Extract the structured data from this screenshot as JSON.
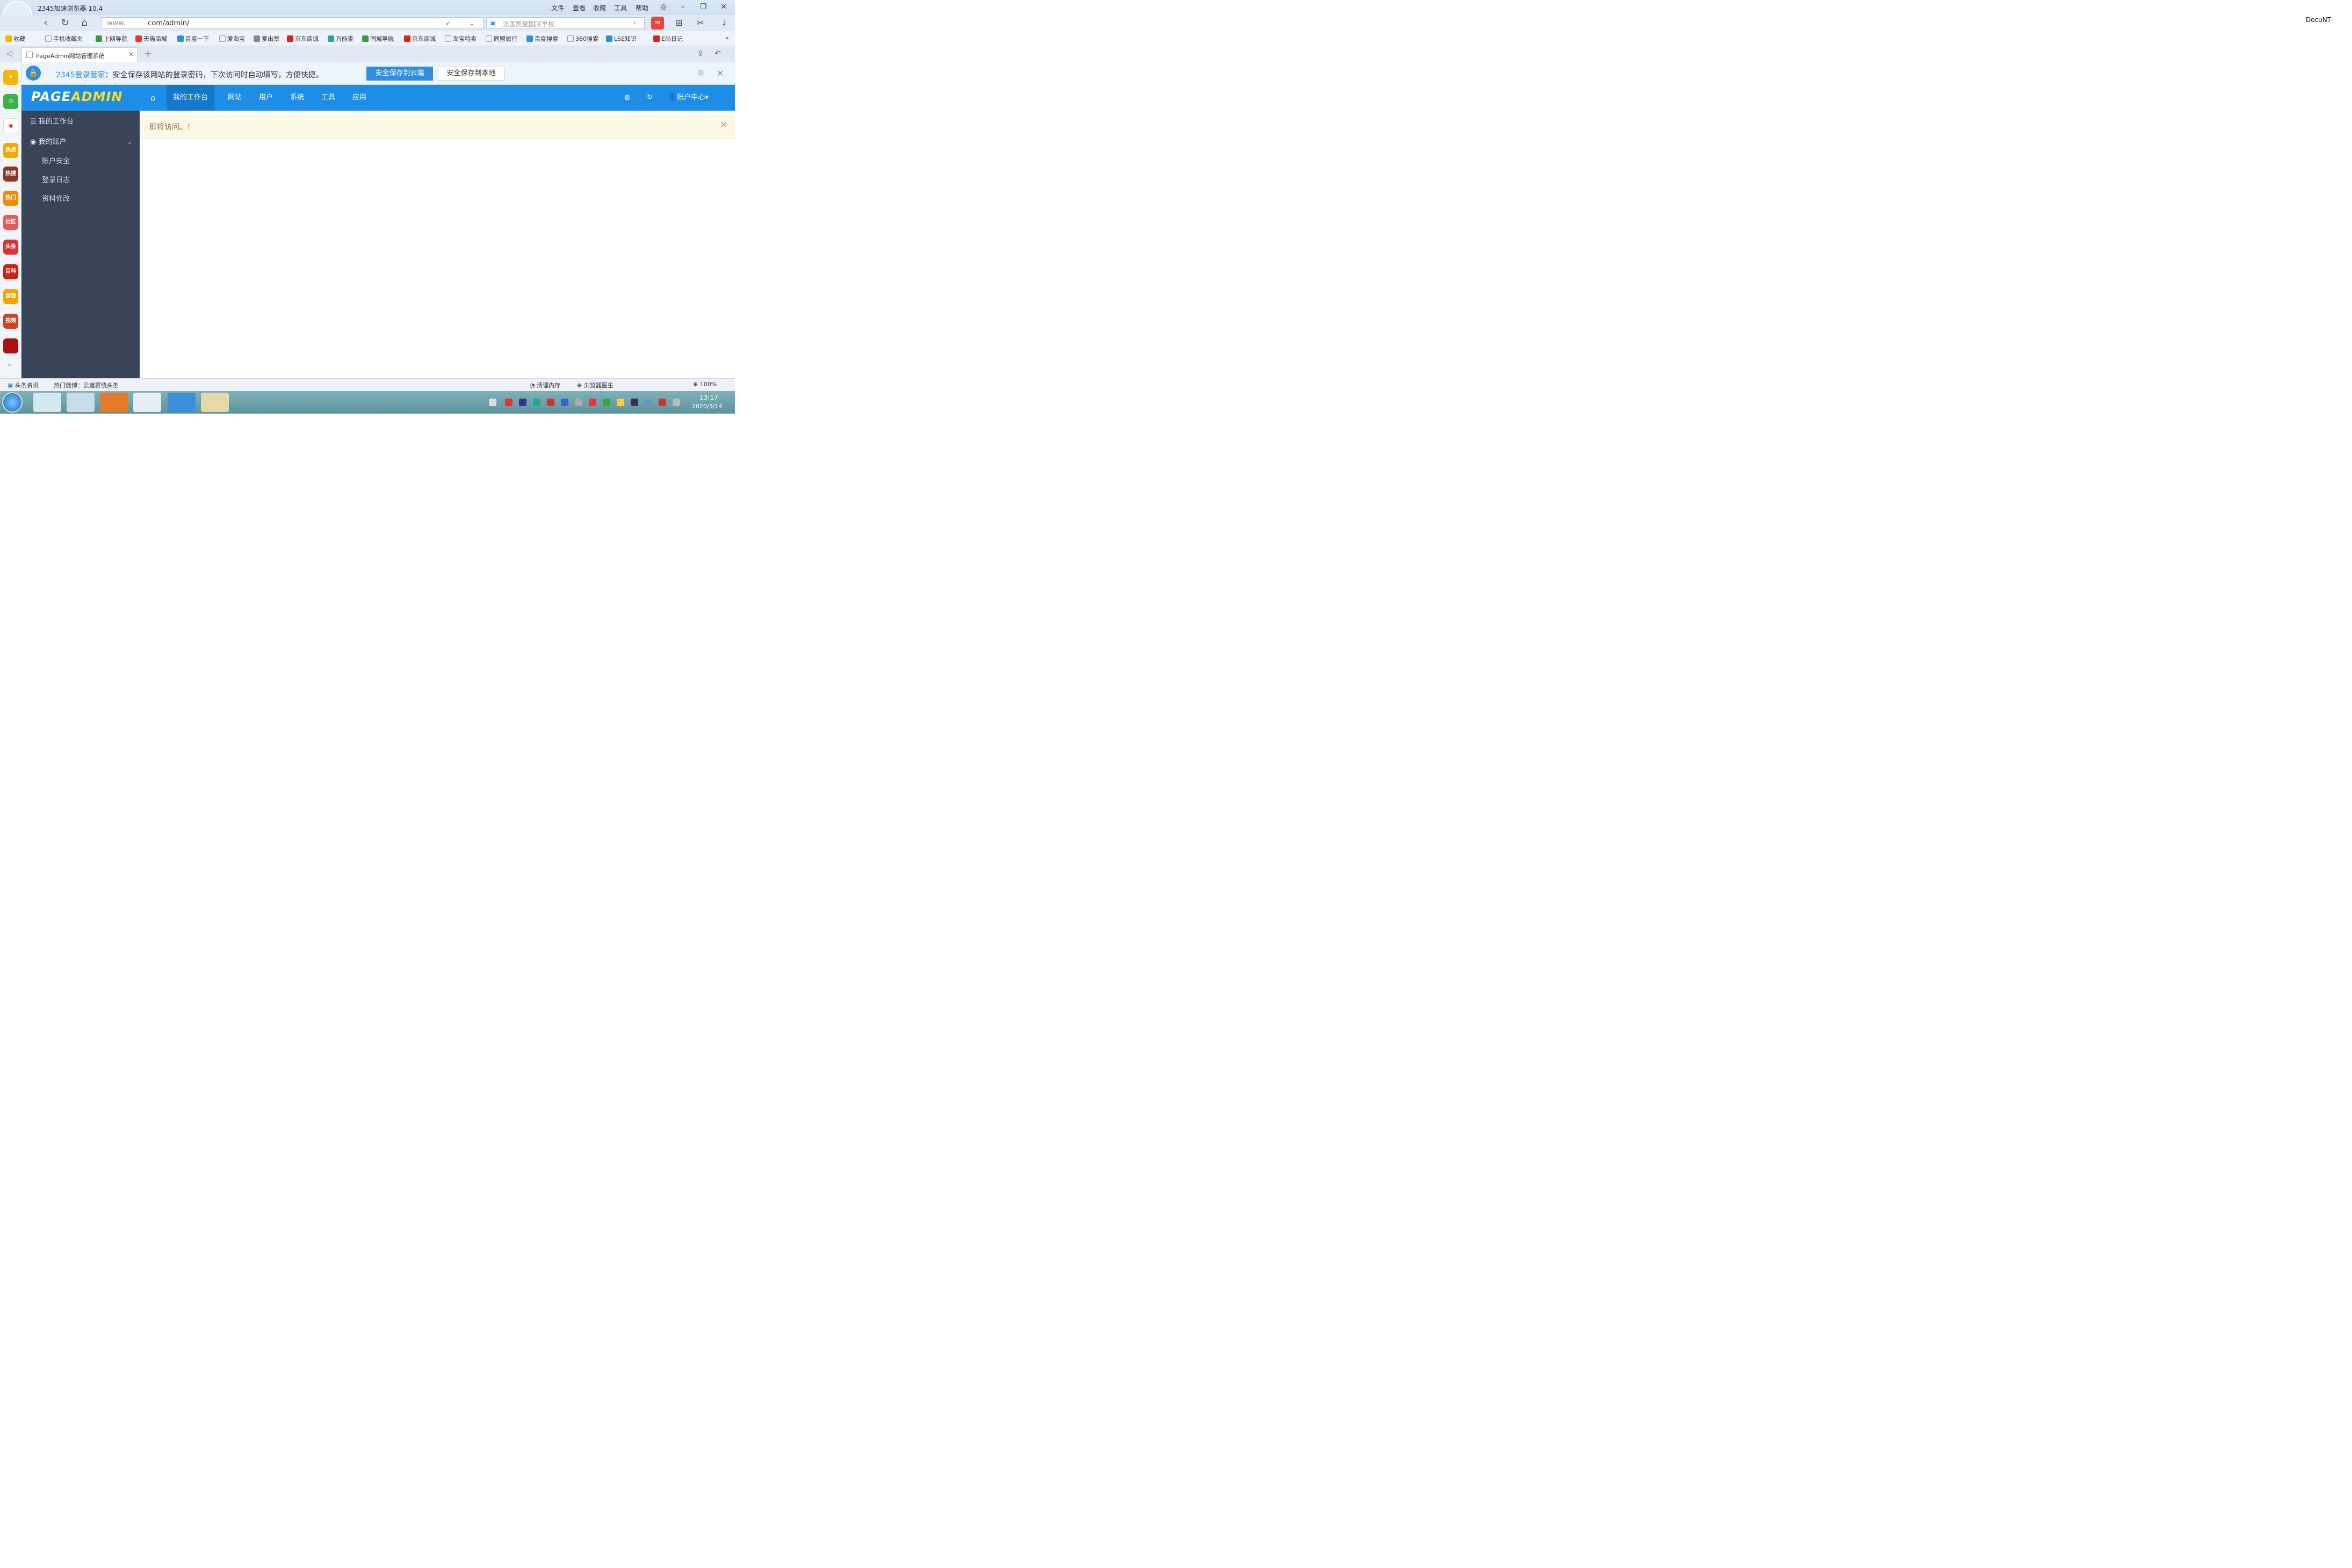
{
  "browser": {
    "title": "2345加速浏览器 10.4",
    "login": "登录",
    "menu": [
      "文件",
      "查看",
      "收藏",
      "工具",
      "帮助"
    ],
    "address": {
      "prefix": "www.",
      "domain": "com/admin/"
    },
    "search_placeholder": "法国凯旋国际学校",
    "bookmarks": [
      "收藏",
      "手机收藏夹",
      "上网导航",
      "天猫商城",
      "百度一下",
      "爱淘宝",
      "爱出票",
      "京东商城",
      "万能查",
      "同城导航",
      "京东商城",
      "淘宝特卖",
      "同盟旅行",
      "百度搜索",
      "360搜索",
      "LSE知识",
      "E尚日记"
    ],
    "tab_title": "PageAdmin网站管理系统",
    "password_bar": {
      "brand": "2345登录管家",
      "message": "：安全保存该网站的登录密码，下次访问时自动填写，方便快捷。",
      "save_cloud": "安全保存到云端",
      "save_local": "安全保存到本地"
    },
    "left_strip": [
      "热点",
      "热搜",
      "热门",
      "社区",
      "头条",
      "百科",
      "游戏",
      "视频"
    ],
    "status_left": "头条资讯",
    "status_hot": "热门微博：云遮雾绕头条",
    "status_items": [
      "清理内存",
      "浏览器医生"
    ],
    "zoom": "100%"
  },
  "app": {
    "logo": {
      "part1": "PAGE",
      "part2": "ADMIN"
    },
    "nav": [
      "我的工作台",
      "网站",
      "用户",
      "系统",
      "工具",
      "应用"
    ],
    "account": "账户中心",
    "sidebar": {
      "workbench": "我的工作台",
      "my_account": "我的账户",
      "items": [
        "账户安全",
        "登录日志",
        "资料修改"
      ]
    },
    "notice": "即将访问。！"
  },
  "taskbar": {
    "time": "13:17",
    "date": "2020/3/14"
  },
  "extra_label": "DocuNT",
  "colors": {
    "header_blue": "#1e8de6",
    "sidebar_dark": "#384458",
    "notice_bg": "#fdf8e6"
  }
}
